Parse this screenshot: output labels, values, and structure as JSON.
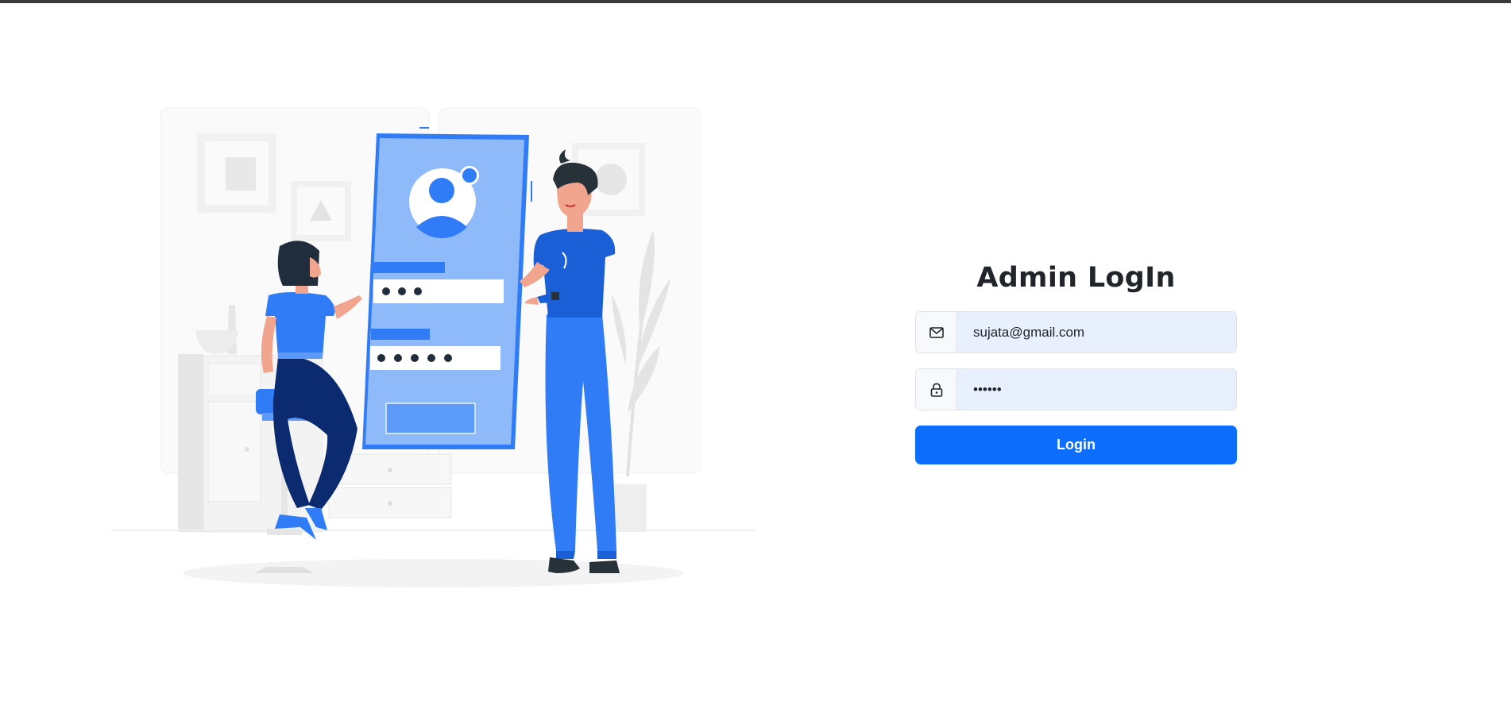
{
  "login": {
    "title": "Admin LogIn",
    "email_value": "sujata@gmail.com",
    "password_value": "••••••",
    "button_label": "Login"
  },
  "icons": {
    "email": "envelope-icon",
    "password": "lock-icon"
  },
  "colors": {
    "accent": "#0d6efd",
    "input_fill": "#e8f0fe",
    "illustration_blue": "#1a73e8",
    "illustration_navy": "#0b2a6f"
  }
}
